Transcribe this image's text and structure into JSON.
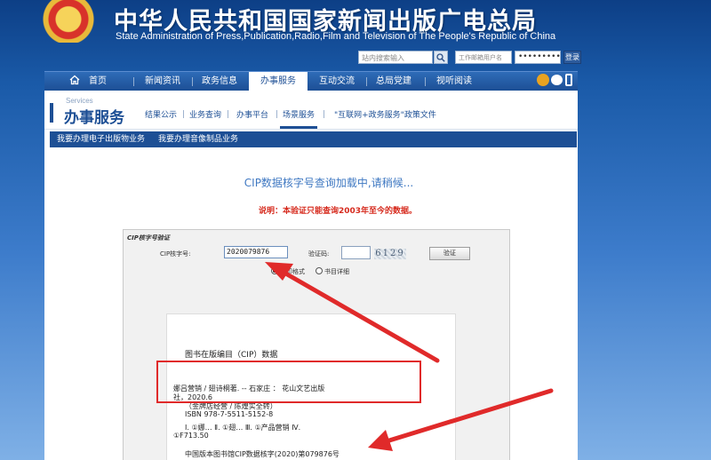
{
  "header": {
    "title_cn": "中华人民共和国国家新闻出版广电总局",
    "title_en": "State Administration of Press,Publication,Radio,Film and Television of The People's Republic of China"
  },
  "search": {
    "placeholder": "站内搜索输入",
    "email_placeholder": "工作邮箱用户名",
    "password_mask": "•••••••••",
    "login_label": "登录"
  },
  "nav": {
    "items": [
      "首页",
      "新闻资讯",
      "政务信息",
      "办事服务",
      "互动交流",
      "总局党建",
      "视听阅读"
    ],
    "active": "办事服务"
  },
  "section": {
    "en": "Services",
    "cn": "办事服务",
    "subnav": [
      "结果公示",
      "业务查询",
      "办事平台",
      "场景服务",
      "\"互联网+政务服务\"政策文件"
    ],
    "bluebar": [
      "我要办理电子出版物业务",
      "我要办理音像制品业务"
    ]
  },
  "main": {
    "loading_title": "CIP数据核字号查询加载中,请稍候...",
    "notice": "说明：本验证只能查询2003年至今的数据。"
  },
  "form": {
    "box_title": "CIP核字号验证",
    "cip_label": "CIP核字号:",
    "cip_value": "2020079876",
    "captcha_label": "验证码:",
    "captcha_text": "6129",
    "verify_button": "验证",
    "radio_print": "打印格式",
    "radio_detail": "书目详细"
  },
  "cip_record": {
    "heading": "图书在版编目（CIP）数据",
    "line1": "娜吕营销 / 翅诗桐著. -- 石家庄 ： 花山文艺出版",
    "line2": "社，2020.6",
    "line3": "（金牌店经营 / 陈煌实全转）",
    "line4": "ISBN 978-7-5511-5152-8",
    "line5": "Ⅰ. ①娜… Ⅱ. ①翅… Ⅲ. ①产品营销 Ⅳ.",
    "line6": "①F713.50",
    "line7": "中国版本图书馆CIP数据核字(2020)第079876号"
  },
  "colors": {
    "brand_blue": "#1d4f95",
    "notice_red": "#d62a1d",
    "annotation_red": "#e02a2a",
    "loading_blue": "#3f78c2"
  }
}
